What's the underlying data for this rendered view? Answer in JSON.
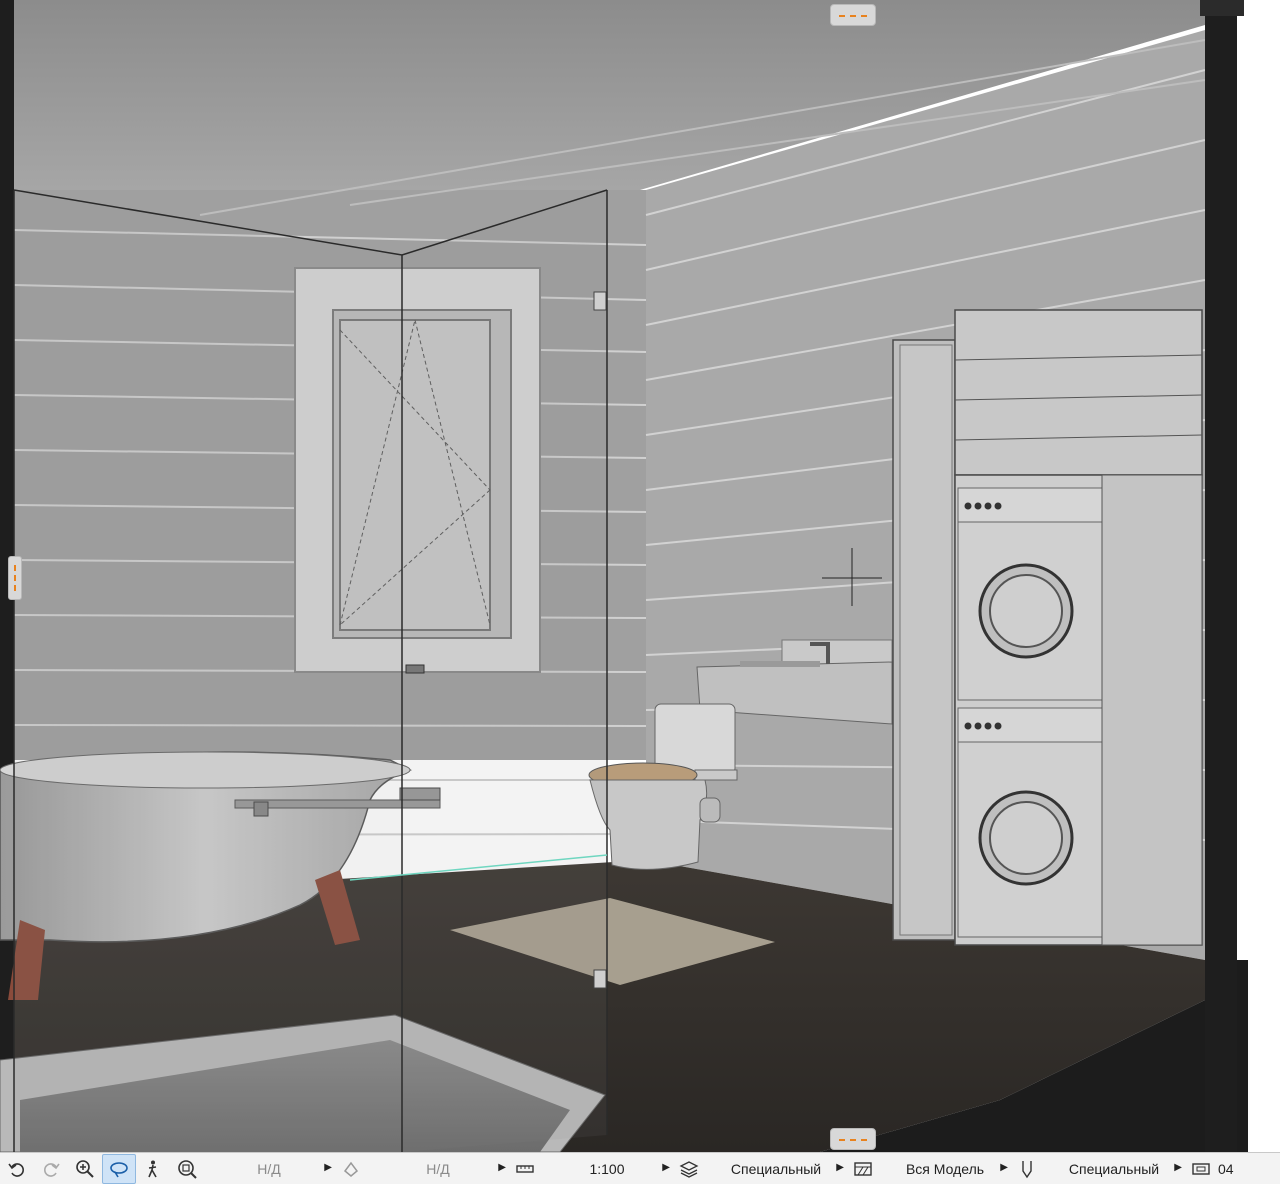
{
  "viewport": {
    "scene": "3D section view: bathroom"
  },
  "statusbar": {
    "undo_icon": "undo-icon",
    "redo_icon": "redo-icon",
    "zoom_icon": "zoom-in-icon",
    "orbit_icon": "orbit-icon",
    "walk_icon": "walk-icon",
    "fit_icon": "fit-view-icon",
    "field1": "Н/Д",
    "field2": "Н/Д",
    "scale": "1:100",
    "layer_combination": "Специальный",
    "model_view": "Вся Модель",
    "pen_set": "Специальный",
    "last": "04"
  },
  "colors": {
    "accent": "#e8821e",
    "floor": "#3a3530",
    "wall": "#a9a9a9",
    "active_button": "#cfe3f7"
  }
}
